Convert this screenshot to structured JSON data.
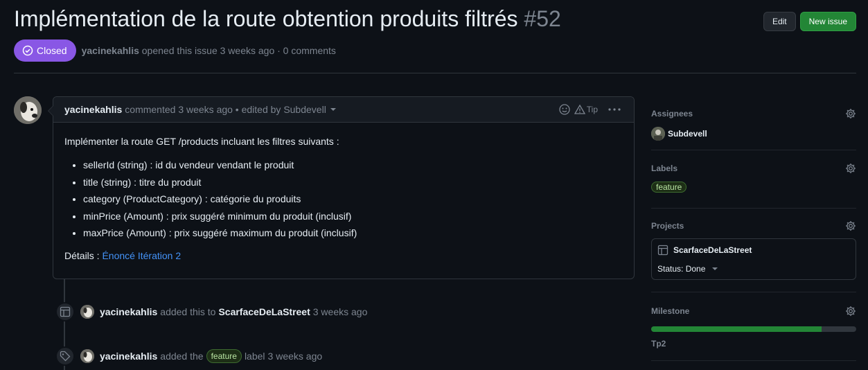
{
  "issue": {
    "title": "Implémentation de la route obtention produits filtrés",
    "number": "#52",
    "state": "Closed",
    "author": "yacinekahlis",
    "opened_text": "opened this issue 3 weeks ago · 0 comments"
  },
  "header": {
    "edit_label": "Edit",
    "new_issue_label": "New issue"
  },
  "comment": {
    "author": "yacinekahlis",
    "meta": "commented 3 weeks ago • edited by Subdevell",
    "tip_label": "Tip",
    "intro": "Implémenter la route GET /products incluant les filtres suivants :",
    "items": [
      "sellerId (string) : id du vendeur vendant le produit",
      "title (string) : titre du produit",
      "category (ProductCategory) : catégorie du produits",
      "minPrice (Amount) : prix suggéré minimum du produit (inclusif)",
      "maxPrice (Amount) : prix suggéré maximum du produit (inclusif)"
    ],
    "details_label": "Détails :",
    "details_link": "Énoncé Itération 2"
  },
  "timeline": [
    {
      "actor": "yacinekahlis",
      "action": "added this to",
      "target": "ScarfaceDeLaStreet",
      "time": "3 weeks ago",
      "icon": "project-table-icon"
    },
    {
      "actor": "yacinekahlis",
      "action": "added the",
      "label": "feature",
      "after": "label",
      "time": "3 weeks ago",
      "icon": "tag-icon"
    }
  ],
  "sidebar": {
    "assignees": {
      "heading": "Assignees",
      "user": "Subdevell"
    },
    "labels": {
      "heading": "Labels",
      "label": "feature"
    },
    "projects": {
      "heading": "Projects",
      "name": "ScarfaceDeLaStreet",
      "status": "Status: Done"
    },
    "milestone": {
      "heading": "Milestone",
      "name": "Tp2",
      "progress": 0.83
    }
  },
  "colors": {
    "accent_closed": "#8957e5",
    "success": "#238636",
    "link": "#4493f8"
  }
}
